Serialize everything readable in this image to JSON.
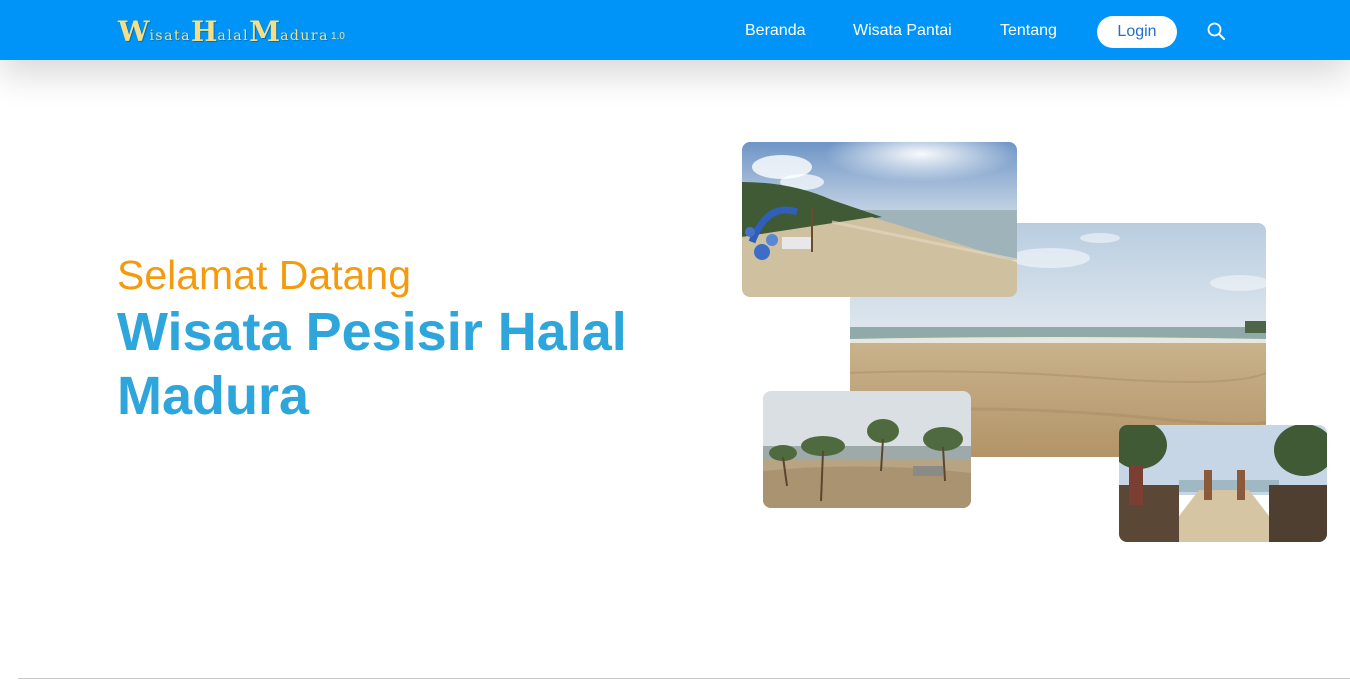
{
  "navbar": {
    "brand": {
      "w": "W",
      "isata": "isata",
      "h": "H",
      "alal": "alal",
      "m": "M",
      "adura": "adura",
      "version": "1.0"
    },
    "links": [
      "Beranda",
      "Wisata Pantai",
      "Tentang"
    ],
    "login_label": "Login",
    "search_icon": "search-icon",
    "background": "#0094f8"
  },
  "hero": {
    "welcome": "Selamat Datang",
    "title": "Wisata Pesisir Halal Madura",
    "welcome_color": "#f59a0c",
    "title_color": "#2ea6dc"
  },
  "gallery": {
    "photos": [
      "beach-photo",
      "beach-panorama-photo",
      "coastal-trees-photo",
      "beach-gate-photo"
    ]
  }
}
